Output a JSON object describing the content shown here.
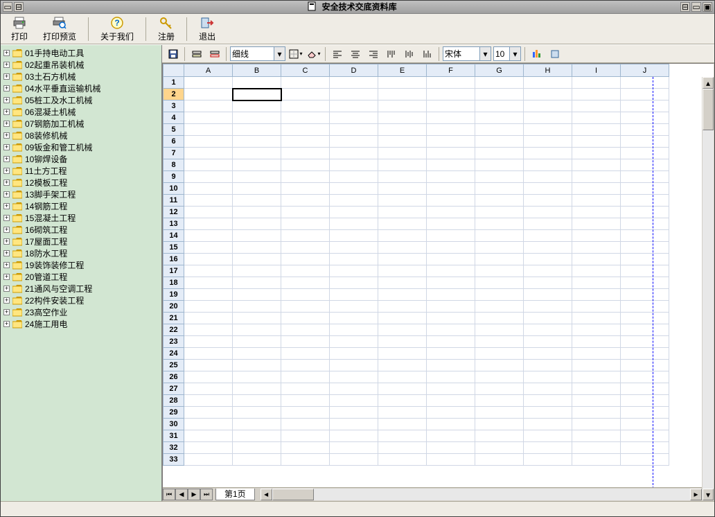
{
  "title": "安全技术交底资料库",
  "toolbar": [
    {
      "label": "打印",
      "icon": "printer"
    },
    {
      "label": "打印预览",
      "icon": "preview"
    },
    {
      "sep": true
    },
    {
      "label": "关于我们",
      "icon": "help"
    },
    {
      "sep": true
    },
    {
      "label": "注册",
      "icon": "key"
    },
    {
      "sep": true
    },
    {
      "label": "退出",
      "icon": "exit"
    }
  ],
  "tree": [
    "01手持电动工具",
    "02起重吊装机械",
    "03土石方机械",
    "04水平垂直运输机械",
    "05桩工及水工机械",
    "06混凝土机械",
    "07钢筋加工机械",
    "08装修机械",
    "09钣金和管工机械",
    "10铆焊设备",
    "11土方工程",
    "12模板工程",
    "13脚手架工程",
    "14钢筋工程",
    "15混凝土工程",
    "16砌筑工程",
    "17屋面工程",
    "18防水工程",
    "19装饰装修工程",
    "20管道工程",
    "21通风与空调工程",
    "22构件安装工程",
    "23高空作业",
    "24施工用电"
  ],
  "sheet_toolbar": {
    "line_style": "细线",
    "font_name": "宋体",
    "font_size": "10"
  },
  "columns": [
    "A",
    "B",
    "C",
    "D",
    "E",
    "F",
    "G",
    "H",
    "I",
    "J"
  ],
  "row_count": 33,
  "selected_cell": {
    "row": 2,
    "col": "B"
  },
  "sheet_tab": "第1页"
}
